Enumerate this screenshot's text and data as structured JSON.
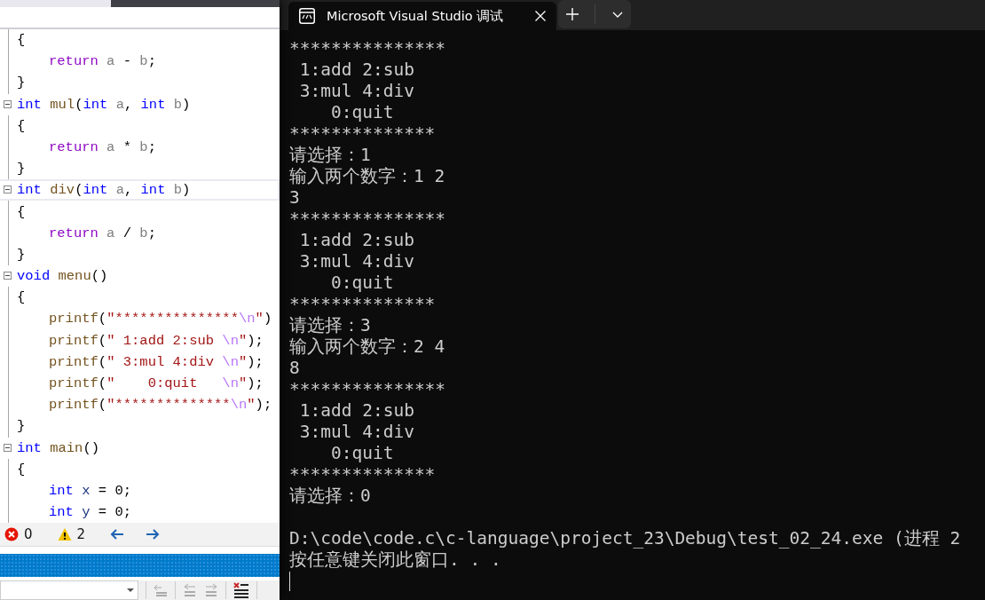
{
  "editor": {
    "lines": [
      {
        "fold": false,
        "indented": false,
        "current": false,
        "tokens": [
          {
            "kind": "plain",
            "text": "{"
          }
        ]
      },
      {
        "fold": false,
        "indented": true,
        "current": false,
        "tokens": [
          {
            "kind": "control",
            "text": "return"
          },
          {
            "kind": "param",
            "text": " a"
          },
          {
            "kind": "plain",
            "text": " - "
          },
          {
            "kind": "param",
            "text": "b"
          },
          {
            "kind": "plain",
            "text": ";"
          }
        ]
      },
      {
        "fold": false,
        "indented": false,
        "current": false,
        "tokens": [
          {
            "kind": "plain",
            "text": "}"
          }
        ]
      },
      {
        "fold": true,
        "indented": false,
        "current": false,
        "tokens": [
          {
            "kind": "keyword",
            "text": "int"
          },
          {
            "kind": "function",
            "text": " mul"
          },
          {
            "kind": "plain",
            "text": "("
          },
          {
            "kind": "keyword",
            "text": "int"
          },
          {
            "kind": "param",
            "text": " a"
          },
          {
            "kind": "plain",
            "text": ", "
          },
          {
            "kind": "keyword",
            "text": "int"
          },
          {
            "kind": "param",
            "text": " b"
          },
          {
            "kind": "plain",
            "text": ")"
          }
        ]
      },
      {
        "fold": false,
        "indented": false,
        "current": false,
        "tokens": [
          {
            "kind": "plain",
            "text": "{"
          }
        ]
      },
      {
        "fold": false,
        "indented": true,
        "current": false,
        "tokens": [
          {
            "kind": "control",
            "text": "return"
          },
          {
            "kind": "param",
            "text": " a"
          },
          {
            "kind": "plain",
            "text": " * "
          },
          {
            "kind": "param",
            "text": "b"
          },
          {
            "kind": "plain",
            "text": ";"
          }
        ]
      },
      {
        "fold": false,
        "indented": false,
        "current": false,
        "tokens": [
          {
            "kind": "plain",
            "text": "}"
          }
        ]
      },
      {
        "fold": true,
        "indented": false,
        "current": true,
        "tokens": [
          {
            "kind": "keyword",
            "text": "int"
          },
          {
            "kind": "function",
            "text": " div"
          },
          {
            "kind": "plain",
            "text": "("
          },
          {
            "kind": "keyword",
            "text": "int"
          },
          {
            "kind": "param",
            "text": " a"
          },
          {
            "kind": "plain",
            "text": ", "
          },
          {
            "kind": "keyword",
            "text": "int"
          },
          {
            "kind": "param",
            "text": " b"
          },
          {
            "kind": "plain",
            "text": ")"
          }
        ]
      },
      {
        "fold": false,
        "indented": false,
        "current": false,
        "tokens": [
          {
            "kind": "plain",
            "text": "{"
          }
        ]
      },
      {
        "fold": false,
        "indented": true,
        "current": false,
        "tokens": [
          {
            "kind": "control",
            "text": "return"
          },
          {
            "kind": "param",
            "text": " a"
          },
          {
            "kind": "plain",
            "text": " / "
          },
          {
            "kind": "param",
            "text": "b"
          },
          {
            "kind": "plain",
            "text": ";"
          }
        ]
      },
      {
        "fold": false,
        "indented": false,
        "current": false,
        "tokens": [
          {
            "kind": "plain",
            "text": "}"
          }
        ]
      },
      {
        "fold": true,
        "indented": false,
        "current": false,
        "tokens": [
          {
            "kind": "keyword",
            "text": "void"
          },
          {
            "kind": "function",
            "text": " menu"
          },
          {
            "kind": "plain",
            "text": "()"
          }
        ]
      },
      {
        "fold": false,
        "indented": false,
        "current": false,
        "tokens": [
          {
            "kind": "plain",
            "text": "{"
          }
        ]
      },
      {
        "fold": false,
        "indented": true,
        "current": false,
        "tokens": [
          {
            "kind": "function",
            "text": "printf"
          },
          {
            "kind": "plain",
            "text": "("
          },
          {
            "kind": "string",
            "text": "\"***************"
          },
          {
            "kind": "escape",
            "text": "\\n"
          },
          {
            "kind": "string",
            "text": "\""
          },
          {
            "kind": "plain",
            "text": ")"
          }
        ]
      },
      {
        "fold": false,
        "indented": true,
        "current": false,
        "tokens": [
          {
            "kind": "function",
            "text": "printf"
          },
          {
            "kind": "plain",
            "text": "("
          },
          {
            "kind": "string",
            "text": "\" 1:add 2:sub "
          },
          {
            "kind": "escape",
            "text": "\\n"
          },
          {
            "kind": "string",
            "text": "\""
          },
          {
            "kind": "plain",
            "text": ");"
          }
        ]
      },
      {
        "fold": false,
        "indented": true,
        "current": false,
        "tokens": [
          {
            "kind": "function",
            "text": "printf"
          },
          {
            "kind": "plain",
            "text": "("
          },
          {
            "kind": "string",
            "text": "\" 3:mul 4:div "
          },
          {
            "kind": "escape",
            "text": "\\n"
          },
          {
            "kind": "string",
            "text": "\""
          },
          {
            "kind": "plain",
            "text": ");"
          }
        ]
      },
      {
        "fold": false,
        "indented": true,
        "current": false,
        "tokens": [
          {
            "kind": "function",
            "text": "printf"
          },
          {
            "kind": "plain",
            "text": "("
          },
          {
            "kind": "string",
            "text": "\"    0:quit   "
          },
          {
            "kind": "escape",
            "text": "\\n"
          },
          {
            "kind": "string",
            "text": "\""
          },
          {
            "kind": "plain",
            "text": ");"
          }
        ]
      },
      {
        "fold": false,
        "indented": true,
        "current": false,
        "tokens": [
          {
            "kind": "function",
            "text": "printf"
          },
          {
            "kind": "plain",
            "text": "("
          },
          {
            "kind": "string",
            "text": "\"**************"
          },
          {
            "kind": "escape",
            "text": "\\n"
          },
          {
            "kind": "string",
            "text": "\""
          },
          {
            "kind": "plain",
            "text": ");"
          }
        ]
      },
      {
        "fold": false,
        "indented": false,
        "current": false,
        "tokens": [
          {
            "kind": "plain",
            "text": "}"
          }
        ]
      },
      {
        "fold": true,
        "indented": false,
        "current": false,
        "tokens": [
          {
            "kind": "keyword",
            "text": "int"
          },
          {
            "kind": "function",
            "text": " main"
          },
          {
            "kind": "plain",
            "text": "()"
          }
        ]
      },
      {
        "fold": false,
        "indented": false,
        "current": false,
        "tokens": [
          {
            "kind": "plain",
            "text": "{"
          }
        ]
      },
      {
        "fold": false,
        "indented": true,
        "current": false,
        "tokens": [
          {
            "kind": "keyword",
            "text": "int"
          },
          {
            "kind": "local",
            "text": " x"
          },
          {
            "kind": "plain",
            "text": " = 0;"
          }
        ]
      },
      {
        "fold": false,
        "indented": true,
        "current": false,
        "tokens": [
          {
            "kind": "keyword",
            "text": "int"
          },
          {
            "kind": "local",
            "text": " y"
          },
          {
            "kind": "plain",
            "text": " = 0;"
          }
        ]
      }
    ]
  },
  "status_bar": {
    "errors": "0",
    "warnings": "2"
  },
  "terminal": {
    "tab_title": "Microsoft Visual Studio 调试",
    "lines": [
      "***************",
      " 1:add 2:sub",
      " 3:mul 4:div",
      "    0:quit",
      "**************",
      "请选择：1",
      "输入两个数字：1 2",
      "3",
      "***************",
      " 1:add 2:sub",
      " 3:mul 4:div",
      "    0:quit",
      "**************",
      "请选择：3",
      "输入两个数字：2 4",
      "8",
      "***************",
      " 1:add 2:sub",
      " 3:mul 4:div",
      "    0:quit",
      "**************",
      "请选择：0",
      "D:\\code\\code.c\\c-language\\project_23\\Debug\\test_02_24.exe (进程 2",
      "按任意键关闭此窗口. . ."
    ]
  }
}
